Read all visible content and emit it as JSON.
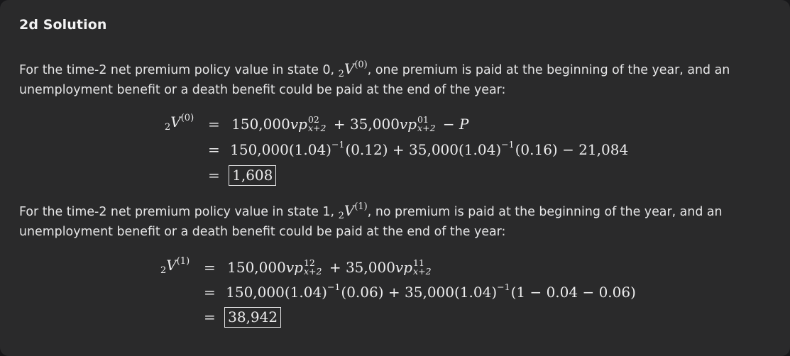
{
  "section_title": "2d Solution",
  "para1": {
    "before": "For the time-2 net premium policy value in state 0, ",
    "after": ", one premium is paid at the beginning of the year, and an unemployment benefit or a death benefit could be paid at the end of the year:"
  },
  "para2": {
    "before": "For the time-2 net premium policy value in state 1, ",
    "after": ", no premium is paid at the beginning of the year, and an unemployment benefit or a death benefit could be paid at the end of the year:"
  },
  "state0": {
    "lhs_state": "(0)",
    "line1": {
      "c1": "150,000",
      "sup1": "02",
      "c2": "35,000",
      "sup2": "01",
      "tail": "P"
    },
    "line2": "150,000(1.04)",
    "line2b": "(0.12) + 35,000(1.04)",
    "line2c": "(0.16) − 21,084",
    "result": "1,608"
  },
  "state1": {
    "lhs_state": "(1)",
    "line1": {
      "c1": "150,000",
      "sup1": "12",
      "c2": "35,000",
      "sup2": "11"
    },
    "line2": "150,000(1.04)",
    "line2b": "(0.06) + 35,000(1.04)",
    "line2c": "(1 − 0.04 − 0.06)",
    "result": "38,942"
  },
  "common": {
    "exp": "−1",
    "sub": "x+2",
    "presub": "2",
    "V": "V",
    "v": "v",
    "p": "p",
    "eq": "=",
    "plus": "+",
    "minus": "−"
  }
}
